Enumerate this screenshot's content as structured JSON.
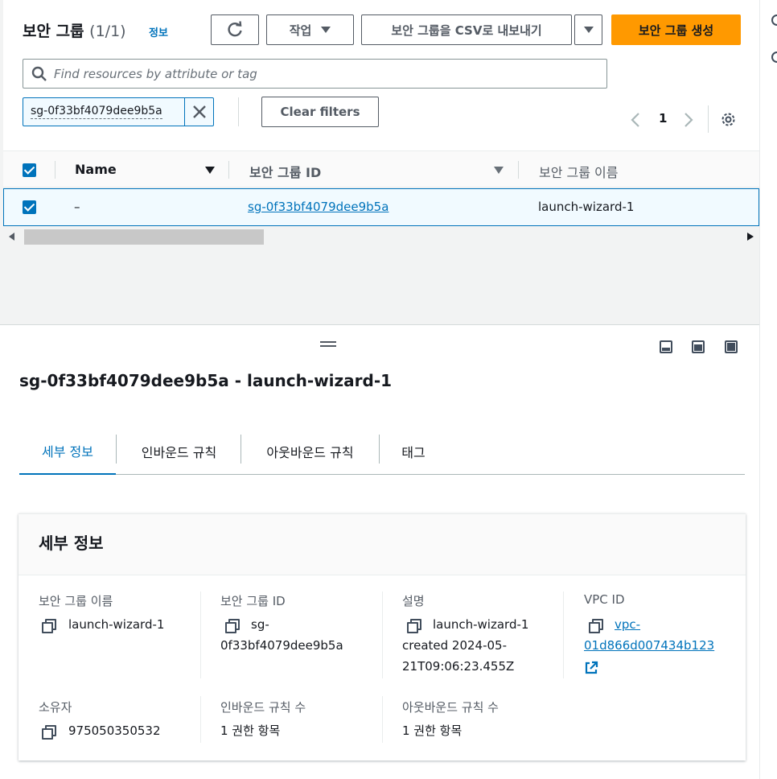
{
  "header": {
    "title": "보안 그룹",
    "count": "(1/1)",
    "info": "정보",
    "actions_label": "작업",
    "export_label": "보안 그룹을 CSV로 내보내기",
    "create_label": "보안 그룹 생성"
  },
  "search": {
    "placeholder": "Find resources by attribute or tag"
  },
  "filter": {
    "token": "sg-0f33bf4079dee9b5a",
    "clear_label": "Clear filters"
  },
  "pagination": {
    "page": "1"
  },
  "table": {
    "columns": [
      "Name",
      "보안 그룹 ID",
      "보안 그룹 이름"
    ],
    "rows": [
      {
        "name": "–",
        "group_id": "sg-0f33bf4079dee9b5a",
        "group_name": "launch-wizard-1",
        "selected": true
      }
    ]
  },
  "detail": {
    "title": "sg-0f33bf4079dee9b5a - launch-wizard-1",
    "tabs": [
      "세부 정보",
      "인바운드 규칙",
      "아웃바운드 규칙",
      "태그"
    ],
    "active_tab": "세부 정보",
    "card_title": "세부 정보",
    "fields": {
      "group_name_label": "보안 그룹 이름",
      "group_name": "launch-wizard-1",
      "group_id_label": "보안 그룹 ID",
      "group_id_line1": "sg-",
      "group_id_line2": "0f33bf4079dee9b5a",
      "description_label": "설명",
      "description_line1": "launch-wizard-1",
      "description_line2": "created 2024-05-",
      "description_line3": "21T09:06:23.455Z",
      "vpc_label": "VPC ID",
      "vpc_line1": "vpc-",
      "vpc_line2": "01d866d007434b123",
      "owner_label": "소유자",
      "owner": "975050350532",
      "inbound_count_label": "인바운드 규칙 수",
      "inbound_count": "1 권한 항목",
      "outbound_count_label": "아웃바운드 규칙 수",
      "outbound_count": "1 권한 항목"
    }
  },
  "colors": {
    "primary": "#ff9900",
    "link": "#0073bb",
    "selected_row_bg": "#f1faff"
  }
}
